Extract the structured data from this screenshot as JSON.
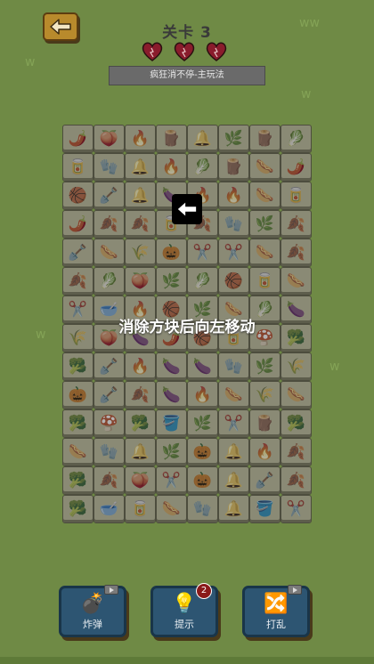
{
  "header": {
    "level_title": "关卡 3",
    "mode_banner": "疯狂消不停-主玩法",
    "lives": 3,
    "back_icon": "arrow-left-icon"
  },
  "board": {
    "rows": [
      [
        "🌶️",
        "🍑",
        "🔥",
        "🪵",
        "🔔",
        "🌿",
        "🪵",
        "🥬"
      ],
      [
        "🥫",
        "🧤",
        "🔔",
        "🔥",
        "🥬",
        "🪵",
        "🌭",
        "🌶️"
      ],
      [
        "🏀",
        "🪏",
        "🔔",
        "🍆",
        "🔥",
        "🔥",
        "🌭",
        "🥫"
      ],
      [
        "🌶️",
        "🍂",
        "🍂",
        "🥫",
        "🍂",
        "🧤",
        "🌿",
        "🍂"
      ],
      [
        "🪏",
        "🌭",
        "🌾",
        "🎃",
        "✂️",
        "✂️",
        "🌭",
        "🍂"
      ],
      [
        "🍂",
        "🥬",
        "🍑",
        "🌿",
        "🥬",
        "🏀",
        "🥫",
        "🌭"
      ],
      [
        "✂️",
        "🥣",
        "🔥",
        "🏀",
        "🌿",
        "🌭",
        "🥬",
        "🍆"
      ],
      [
        "🌾",
        "🍑",
        "🍆",
        "🌶️",
        "🏀",
        "🥫",
        "🍄",
        "🥦"
      ],
      [
        "🥦",
        "🪏",
        "🔥",
        "🍆",
        "🍆",
        "🧤",
        "🌿",
        "🌾"
      ],
      [
        "🎃",
        "🪏",
        "🍂",
        "🍆",
        "🔥",
        "🌭",
        "🌾",
        "🌭"
      ],
      [
        "🥦",
        "🍄",
        "🥦",
        "🪣",
        "🌿",
        "✂️",
        "🪵",
        "🥦"
      ],
      [
        "🌭",
        "🧤",
        "🔔",
        "🌿",
        "🎃",
        "🔔",
        "🔥",
        "🍂"
      ],
      [
        "🥦",
        "🍂",
        "🍑",
        "✂️",
        "🎃",
        "🔔",
        "🪏",
        "🍂"
      ],
      [
        "🥦",
        "🥣",
        "🥫",
        "🌭",
        "🧤",
        "🔔",
        "🪣",
        "✂️"
      ]
    ]
  },
  "hint": {
    "text": "消除方块后向左移动",
    "arrow_icon": "arrow-left-icon"
  },
  "tools": {
    "bomb": {
      "label": "炸弹",
      "icon": "bomb-icon",
      "glyph": "💣"
    },
    "hint": {
      "label": "提示",
      "icon": "lightbulb-icon",
      "glyph": "💡",
      "count": "2"
    },
    "shuffle": {
      "label": "打乱",
      "icon": "shuffle-icon",
      "glyph": "🔀"
    }
  },
  "colors": {
    "background": "#6f8a45",
    "tile": "#8a8a75",
    "tool_button": "#2d5572",
    "heart": "#8a1c2c"
  }
}
